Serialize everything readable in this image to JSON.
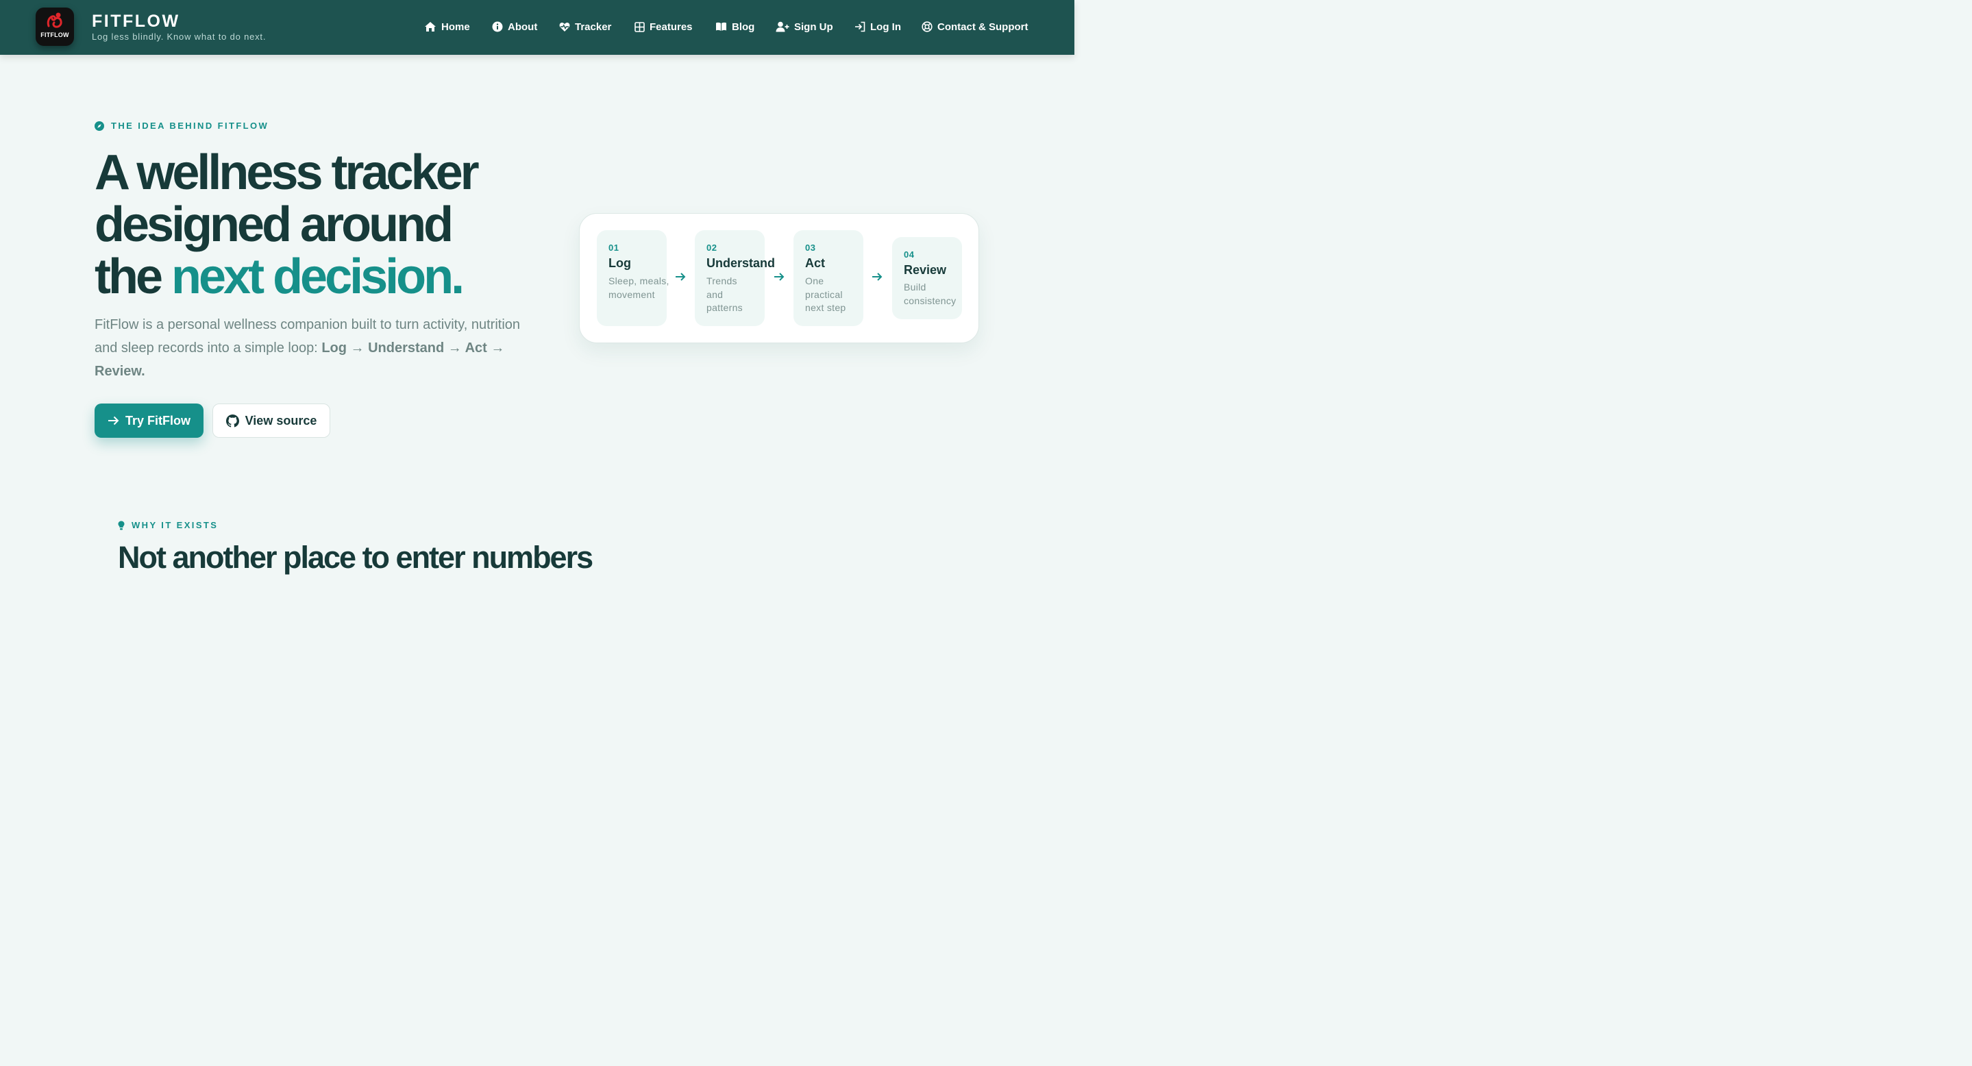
{
  "header": {
    "logo_text": "FITFLOW",
    "brand_name": "FITFLOW",
    "tagline": "Log less blindly. Know what to do next.",
    "nav": [
      {
        "label": "Home",
        "icon": "home-icon"
      },
      {
        "label": "About",
        "icon": "info-icon"
      },
      {
        "label": "Tracker",
        "icon": "heart-pulse-icon"
      },
      {
        "label": "Features",
        "icon": "grid-icon"
      },
      {
        "label": "Blog",
        "icon": "book-icon"
      },
      {
        "label": "Sign Up",
        "icon": "user-plus-icon"
      },
      {
        "label": "Log In",
        "icon": "login-icon"
      },
      {
        "label": "Contact & Support",
        "icon": "lifebuoy-icon"
      }
    ]
  },
  "hero": {
    "eyebrow": "THE IDEA BEHIND FITFLOW",
    "title_line1": "A wellness tracker",
    "title_line2": "designed around",
    "title_line3_plain": "the ",
    "title_line3_accent": "next decision.",
    "description_prefix": "FitFlow is a personal wellness companion built to turn activity, nutrition and sleep records into a simple loop: ",
    "description_loop": "Log → Understand → Act → Review.",
    "primary_button": "Try FitFlow",
    "secondary_button": "View source"
  },
  "loop": {
    "steps": [
      {
        "num": "01",
        "name": "Log",
        "desc": "Sleep, meals, movement"
      },
      {
        "num": "02",
        "name": "Understand",
        "desc": "Trends and patterns"
      },
      {
        "num": "03",
        "name": "Act",
        "desc": "One practical next step"
      },
      {
        "num": "04",
        "name": "Review",
        "desc": "Build consistency"
      }
    ]
  },
  "why": {
    "eyebrow": "WHY IT EXISTS",
    "title": "Not another place to enter numbers"
  },
  "colors": {
    "header_bg": "#1e5350",
    "accent": "#16908a",
    "heading": "#173a39",
    "page_bg": "#f1f7f6"
  }
}
